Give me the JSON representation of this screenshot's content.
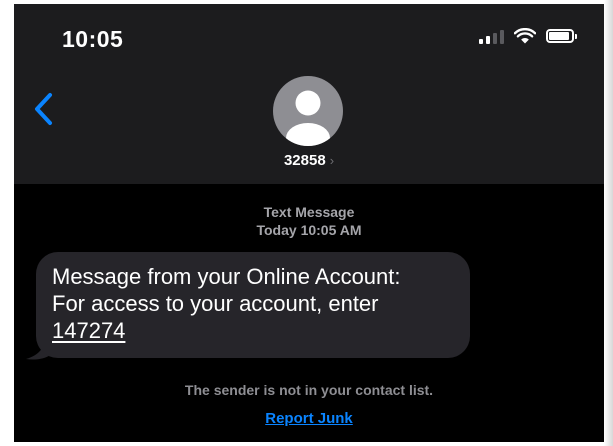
{
  "status_bar": {
    "time": "10:05",
    "signal_icon": "cellular-signal-icon",
    "wifi_icon": "wifi-icon",
    "battery_icon": "battery-icon"
  },
  "header": {
    "back_icon": "chevron-left-icon",
    "avatar_icon": "person-silhouette-icon",
    "contact_name": "32858",
    "contact_chevron": "›"
  },
  "conversation": {
    "meta_type": "Text Message",
    "meta_time": "Today 10:05 AM",
    "message": {
      "line1": "Message from your Online Account:",
      "line2": "For access to your account, enter",
      "code": "147274"
    },
    "sender_notice": "The sender is not in your contact list.",
    "report_label": "Report Junk"
  },
  "colors": {
    "accent": "#0a84ff",
    "bubble": "#26252a",
    "header_bg": "#1c1c1e",
    "background": "#000000"
  }
}
